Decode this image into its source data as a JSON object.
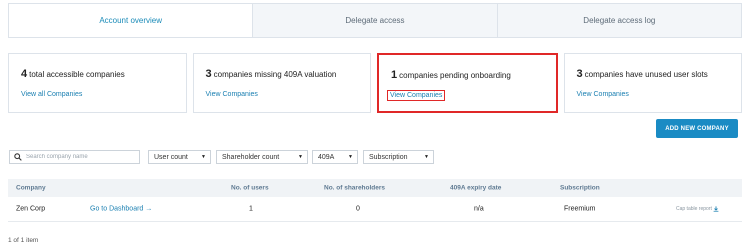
{
  "tabs": [
    "Account overview",
    "Delegate access",
    "Delegate access log"
  ],
  "cards": [
    {
      "count": "4",
      "text": "total accessible companies",
      "link": "View all Companies"
    },
    {
      "count": "3",
      "text": "companies missing 409A valuation",
      "link": "View Companies"
    },
    {
      "count": "1",
      "text": "companies pending onboarding",
      "link": "View Companies"
    },
    {
      "count": "3",
      "text": "companies have unused user slots",
      "link": "View Companies"
    }
  ],
  "add_button": "ADD NEW COMPANY",
  "search": {
    "placeholder": "Search company name"
  },
  "filters": [
    "User count",
    "Shareholder count",
    "409A",
    "Subscription"
  ],
  "table": {
    "headers": [
      "Company",
      "No. of users",
      "No. of shareholders",
      "409A expiry date",
      "Subscription"
    ],
    "rows": [
      {
        "company": "Zen Corp",
        "dashboard_link": "Go to Dashboard",
        "users": "1",
        "shareholders": "0",
        "expiry": "n/a",
        "subscription": "Freemium",
        "report": "Cap table report"
      }
    ]
  },
  "pagination": "1 of 1 item",
  "colors": {
    "accent": "#1a8bc4",
    "highlight": "#e02828"
  }
}
